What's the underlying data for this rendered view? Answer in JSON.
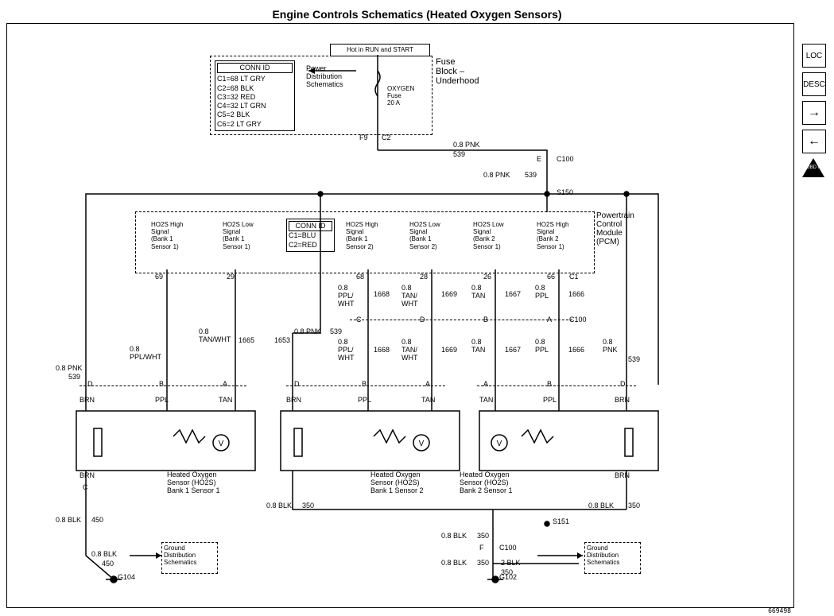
{
  "title": "Engine Controls Schematics (Heated Oxygen Sensors)",
  "docnum": "669498",
  "palette": {
    "loc": "LOC",
    "desc": "DESC",
    "fwd": "→",
    "back": "←",
    "obd": "OBD II"
  },
  "fuse": {
    "hot": "Hot in RUN and START",
    "block": "Fuse\nBlock –\nUnderhood",
    "power": "Power\nDistribution\nSchematics",
    "oxygen": "OXYGEN\nFuse\n20 A",
    "conn_id_hdr": "CONN ID",
    "conn_id": "C1=68 LT GRY\nC2=68 BLK\nC3=32 RED\nC4=32 LT GRN\nC5=2 BLK\nC6=2 LT GRY",
    "pin_f9": "F9",
    "pin_c2": "C2"
  },
  "top_wire": {
    "size": "0.8 PNK",
    "num": "539",
    "e": "E",
    "c100": "C100",
    "pnk2": "0.8 PNK",
    "num2": "539",
    "s150": "S150"
  },
  "pcm": {
    "label": "Powertrain\nControl\nModule\n(PCM)",
    "conn_id_hdr": "CONN ID",
    "conn_id": "C1=BLU\nC2=RED",
    "sigs": [
      "HO2S High\nSignal\n(Bank 1\nSensor 1)",
      "HO2S Low\nSignal\n(Bank 1\nSensor 1)",
      "HO2S High\nSignal\n(Bank 1\nSensor 2)",
      "HO2S Low\nSignal\n(Bank 1\nSensor 2)",
      "HO2S Low\nSignal\n(Bank 2\nSensor 1)",
      "HO2S High\nSignal\n(Bank 2\nSensor 1)"
    ],
    "pins": [
      "69",
      "29",
      "68",
      "28",
      "26",
      "66"
    ],
    "c1_lbl": "C1"
  },
  "mid": {
    "col2": {
      "u": "0.8\nPPL/\nWHT",
      "n": "1668",
      "p": "C"
    },
    "col3": {
      "u": "0.8\nTAN/\nWHT",
      "n": "1669",
      "p": "D"
    },
    "col4": {
      "u": "0.8\nTAN",
      "n": "1667",
      "p": "B"
    },
    "col5": {
      "u": "0.8\nPPL",
      "n": "1666",
      "p": "A"
    },
    "c100": "C100"
  },
  "left": {
    "tan": "0.8\nTAN/WHT",
    "tan_n": "1665",
    "ppl": "0.8\nPPL/WHT",
    "ppl_n": "1653",
    "pnk": "0.8 PNK",
    "pnk_n": "539",
    "lpnk": "0.8 PNK",
    "lpnk_n": "539",
    "pinD": "D",
    "pinB": "B",
    "pinA": "A"
  },
  "row3": {
    "c0": {
      "u": "0.8\nPPL/\nWHT",
      "n": "1668"
    },
    "c1": {
      "u": "0.8\nTAN/\nWHT",
      "n": "1669"
    },
    "c2": {
      "u": "0.8\nTAN",
      "n": "1667"
    },
    "c3": {
      "u": "0.8\nPPL",
      "n": "1666"
    },
    "rpnk": "0.8\nPNK",
    "rpnk_n": "539"
  },
  "row3_pins": [
    "D",
    "B",
    "A",
    "D",
    "B",
    "A",
    "A",
    "B",
    "D"
  ],
  "colors": [
    "BRN",
    "PPL",
    "TAN",
    "BRN",
    "PPL",
    "TAN",
    "TAN",
    "PPL",
    "BRN"
  ],
  "sensors": {
    "s1": "Heated Oxygen\nSensor (HO2S)\nBank 1 Sensor 1",
    "s2": "Heated Oxygen\nSensor (HO2S)\nBank 1 Sensor 2",
    "s3": "Heated Oxygen\nSensor (HO2S)\nBank 2 Sensor 1"
  },
  "bottom": {
    "brn": "BRN",
    "c": "C",
    "blk450": "0.8 BLK",
    "n450": "450",
    "g104": "G104",
    "gnd1": "Ground\nDistribution\nSchematics",
    "gnd2": "Ground\nDistribution\nSchematics",
    "b350a": "0.8 BLK",
    "n350a": "350",
    "s151": "S151",
    "b350b": "0.8 BLK",
    "n350b": "350",
    "b350c": "0.8 BLK",
    "n350c": "350",
    "f": "F",
    "c100": "C100",
    "blk2": "2 BLK",
    "n350d": "350",
    "g102": "G102",
    "brn_r": "BRN",
    "blk350r": "0.8 BLK",
    "n350r": "350"
  }
}
